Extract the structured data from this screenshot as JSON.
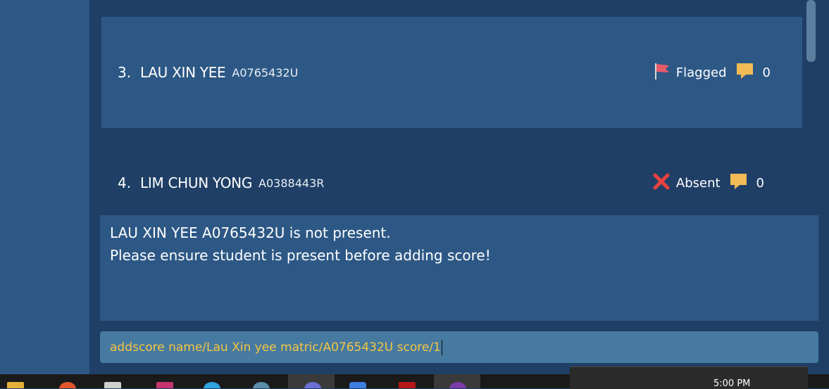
{
  "students": [
    {
      "index": "3.",
      "name": "LAU XIN YEE",
      "matric": "A0765432U",
      "status": "Flagged",
      "status_icon": "flag-icon",
      "comments": "0"
    },
    {
      "index": "4.",
      "name": "LIM CHUN YONG",
      "matric": "A0388443R",
      "status": "Absent",
      "status_icon": "cross-icon",
      "comments": "0"
    }
  ],
  "result": {
    "line1": "LAU XIN YEE A0765432U is not present.",
    "line2": "Please ensure student is present before adding score!"
  },
  "command": {
    "value": "addscore name/Lau Xin yee matric/A0765432U score/1"
  },
  "taskbar": {
    "clock": "5:00 PM"
  },
  "colors": {
    "flag": "#e85b6a",
    "absent": "#e8413e",
    "comment": "#f2bb55",
    "command_text": "#f5c542"
  }
}
